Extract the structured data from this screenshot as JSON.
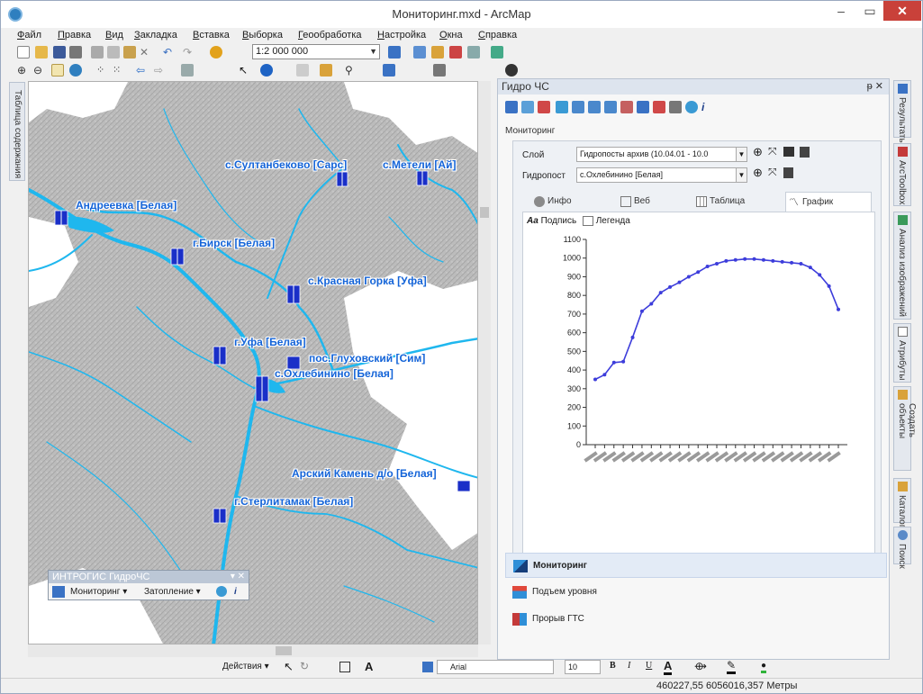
{
  "window": {
    "title": "Мониторинг.mxd - ArcMap",
    "minimize": "–",
    "maximize": "▭",
    "close": "✕"
  },
  "menu": [
    "Файл",
    "Правка",
    "Вид",
    "Закладка",
    "Вставка",
    "Выборка",
    "Геообработка",
    "Настройка",
    "Окна",
    "Справка"
  ],
  "toolbar": {
    "scale": "1:2 000 000"
  },
  "toc": {
    "label": "Таблица содержания"
  },
  "map": {
    "labels": [
      "с.Султанбеково [Сарс]",
      "с.Метели [Ай]",
      "Андреевка [Белая]",
      "г.Бирск [Белая]",
      "с.Красная Горка [Уфа]",
      "г.Уфа [Белая]",
      "пос.Глуховский [Сим]",
      "с.Охлебинино [Белая]",
      "Арский Камень д/о [Белая]",
      "г.Стерлитамак [Белая]"
    ],
    "colors": {
      "water": "#1fb7ee",
      "label": "#1464d8",
      "gauge": "#1a2fc8",
      "terrain": "#b9b9b9"
    }
  },
  "float_toolbar": {
    "title": "ИНТРОГИС ГидроЧС",
    "controls": "▾ ✕",
    "items": [
      "Мониторинг ▾",
      "Затопление ▾"
    ]
  },
  "dock": {
    "title": "Гидро ЧС",
    "pin": "ᵽ ✕",
    "section": "Мониторинг",
    "layer_label": "Слой",
    "layer_value": "Гидропосты архив (10.04.01 - 10.0",
    "gauge_label": "Гидропост",
    "gauge_value": "с.Охлебинино [Белая]",
    "tabs": [
      "Инфо",
      "Веб",
      "Таблица",
      "График"
    ],
    "active_tab": "График",
    "chart_tools": [
      "Подпись",
      "Легенда"
    ],
    "accordion": [
      "Мониторинг",
      "Подъем уровня",
      "Прорыв ГТС"
    ]
  },
  "right_tabs": [
    "Результаты",
    "ArcToolbox",
    "Анализ изображений",
    "Атрибуты",
    "Создать объекты",
    "Каталог",
    "Поиск"
  ],
  "drawbar": {
    "actions": "Действия ▾",
    "font": "Arial",
    "size": "10",
    "bold": "B",
    "italic": "I",
    "underline": "U",
    "text_tool": "A"
  },
  "status": {
    "coords": "460227,55  6056016,357 Метры"
  },
  "chart_data": {
    "type": "line",
    "title": "",
    "xlabel": "",
    "ylabel": "",
    "ylim": [
      0,
      1100
    ],
    "yticks": [
      0,
      100,
      200,
      300,
      400,
      500,
      600,
      700,
      800,
      900,
      1000,
      1100
    ],
    "series": [
      {
        "color": "#3d3ddb",
        "values": [
          350,
          375,
          440,
          445,
          575,
          715,
          755,
          815,
          845,
          870,
          900,
          925,
          955,
          970,
          985,
          990,
          995,
          995,
          990,
          985,
          980,
          975,
          970,
          950,
          910,
          850,
          725
        ]
      }
    ],
    "x_count": 27,
    "x_tick_labels_note": ""
  }
}
